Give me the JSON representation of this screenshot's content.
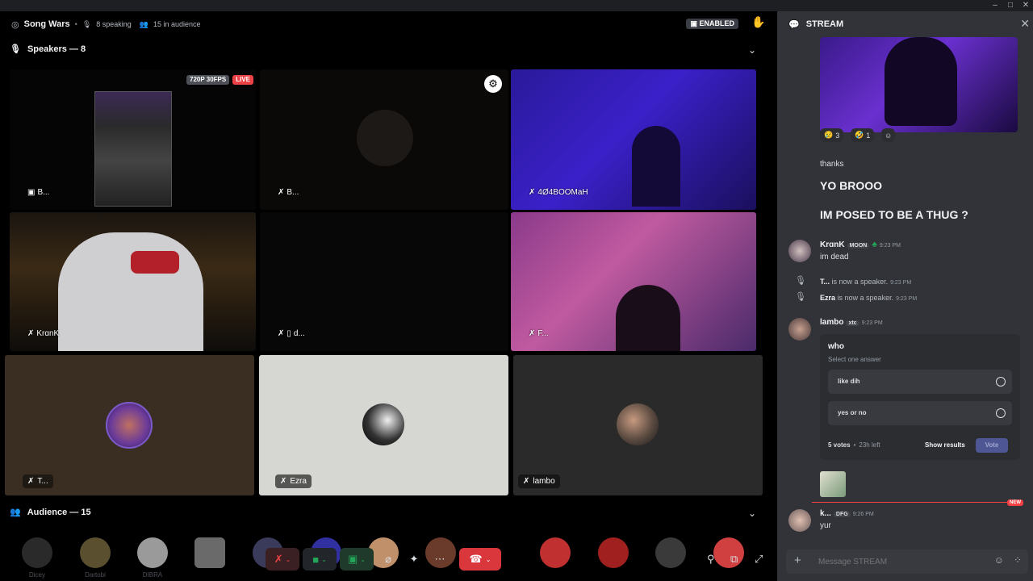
{
  "window": {
    "minimize": "–",
    "maximize": "□",
    "close": "✕"
  },
  "header": {
    "channel_name": "Song Wars",
    "speaking": "8 speaking",
    "audience": "15 in audience",
    "enabled_badge": "ENABLED"
  },
  "speakers_section": {
    "label": "Speakers — 8"
  },
  "audience_section": {
    "label": "Audience — 15"
  },
  "tiles": [
    {
      "name": "B...",
      "badges": {
        "quality": "720P 30FPS",
        "live": "LIVE"
      }
    },
    {
      "name": "B..."
    },
    {
      "name": "4Ø4BOOMaH"
    },
    {
      "name": "KrɑnK"
    },
    {
      "name": "d..."
    },
    {
      "name": "F..."
    },
    {
      "name": "T..."
    },
    {
      "name": "Ezra"
    },
    {
      "name": "lambo"
    }
  ],
  "audience_labels": [
    "Dicey",
    "Dartobi",
    "DIBRA",
    "",
    "",
    "",
    "",
    "",
    "",
    "",
    "",
    "",
    "",
    "",
    ""
  ],
  "stream": {
    "title": "STREAM",
    "reactions": [
      {
        "emoji": "😢",
        "count": "3"
      },
      {
        "emoji": "🤣",
        "count": "1"
      }
    ],
    "messages": {
      "thanks": "thanks",
      "yo": "YO BROOO",
      "thug": "IM POSED TO BE A THUG ?",
      "krank_author": "KrɑnK",
      "krank_tag": "MOON",
      "krank_time": "9:23 PM",
      "krank_text": "im dead",
      "sys1_name": "T...",
      "sys1_text": "is now a speaker.",
      "sys1_time": "9:23 PM",
      "sys2_name": "Ezra",
      "sys2_text": "is now a speaker.",
      "sys2_time": "9:23 PM",
      "lambo_author": "lambo",
      "lambo_tag": "xtc",
      "lambo_time": "9:23 PM",
      "new_badge": "NEW",
      "k_author": "k...",
      "k_tag": "DFG",
      "k_time": "9:26 PM",
      "k_text": "yur"
    },
    "poll": {
      "question": "who",
      "hint": "Select one answer",
      "options": [
        "like dih",
        "yes or no"
      ],
      "votes": "5 votes",
      "time_left": "23h left",
      "show_results": "Show results",
      "vote": "Vote"
    },
    "composer_placeholder": "Message STREAM"
  },
  "colors": {
    "live": "#ed4245",
    "hangup": "#da373c",
    "vote_button": "#4e5693",
    "new_line": "#f23f43",
    "accent_green": "#23a55a"
  }
}
